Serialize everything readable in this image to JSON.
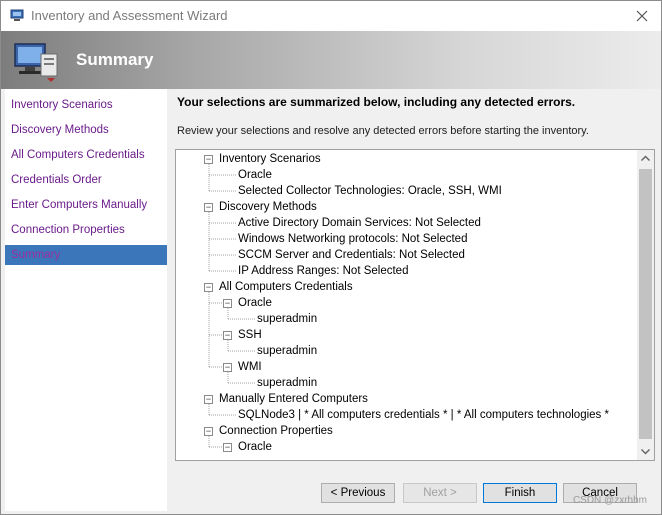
{
  "window": {
    "title": "Inventory and Assessment Wizard",
    "banner_title": "Summary",
    "icons": {
      "app": "wizard-app-icon",
      "banner": "computer-network-icon",
      "close": "close-icon"
    }
  },
  "sidebar": {
    "items": [
      {
        "label": "Inventory Scenarios",
        "active": false
      },
      {
        "label": "Discovery Methods",
        "active": false
      },
      {
        "label": "All Computers Credentials",
        "active": false
      },
      {
        "label": "Credentials Order",
        "active": false
      },
      {
        "label": "Enter Computers Manually",
        "active": false
      },
      {
        "label": "Connection Properties",
        "active": false
      },
      {
        "label": "Summary",
        "active": true
      }
    ]
  },
  "main": {
    "heading": "Your selections are summarized below, including any detected errors.",
    "subtext": "Review your selections and resolve any detected errors before starting the inventory.",
    "tree": [
      {
        "label": "Inventory Scenarios",
        "level": 0,
        "expander": true
      },
      {
        "label": "Oracle",
        "level": 1,
        "expander": false
      },
      {
        "label": "Selected Collector Technologies: Oracle, SSH, WMI",
        "level": 1,
        "expander": false
      },
      {
        "label": "Discovery Methods",
        "level": 0,
        "expander": true
      },
      {
        "label": "Active Directory Domain Services: Not Selected",
        "level": 1,
        "expander": false
      },
      {
        "label": "Windows Networking protocols: Not Selected",
        "level": 1,
        "expander": false
      },
      {
        "label": "SCCM Server and Credentials: Not Selected",
        "level": 1,
        "expander": false
      },
      {
        "label": "IP Address Ranges: Not Selected",
        "level": 1,
        "expander": false
      },
      {
        "label": "All Computers Credentials",
        "level": 0,
        "expander": true
      },
      {
        "label": "Oracle",
        "level": 1,
        "expander": true
      },
      {
        "label": "superadmin",
        "level": 2,
        "expander": false
      },
      {
        "label": "SSH",
        "level": 1,
        "expander": true
      },
      {
        "label": "superadmin",
        "level": 2,
        "expander": false
      },
      {
        "label": "WMI",
        "level": 1,
        "expander": true
      },
      {
        "label": "superadmin",
        "level": 2,
        "expander": false
      },
      {
        "label": "Manually Entered Computers",
        "level": 0,
        "expander": true
      },
      {
        "label": "SQLNode3 | * All computers credentials * | * All computers technologies *",
        "level": 1,
        "expander": false
      },
      {
        "label": "Connection Properties",
        "level": 0,
        "expander": true
      },
      {
        "label": "Oracle",
        "level": 1,
        "expander": true
      }
    ]
  },
  "footer": {
    "previous": "< Previous",
    "next": "Next >",
    "finish": "Finish",
    "cancel": "Cancel",
    "next_enabled": false
  },
  "watermark": "CSDN @zxrhhm"
}
